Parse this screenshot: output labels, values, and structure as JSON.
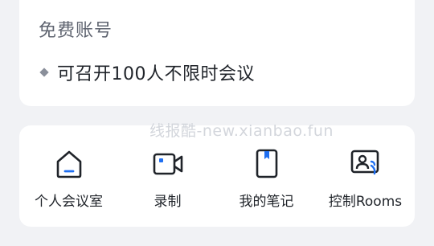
{
  "account": {
    "title": "免费账号",
    "feature": "可召开100人不限时会议"
  },
  "watermark": "线报酷-new.xianbao.fun",
  "actions": [
    {
      "label": "个人会议室",
      "icon": "home-icon"
    },
    {
      "label": "录制",
      "icon": "video-camera-icon"
    },
    {
      "label": "我的笔记",
      "icon": "notebook-icon"
    },
    {
      "label": "控制Rooms",
      "icon": "rooms-control-icon"
    }
  ],
  "colors": {
    "background": "#f1f2f5",
    "card": "#ffffff",
    "icon_stroke": "#1f2329",
    "accent": "#1f6ff1"
  }
}
